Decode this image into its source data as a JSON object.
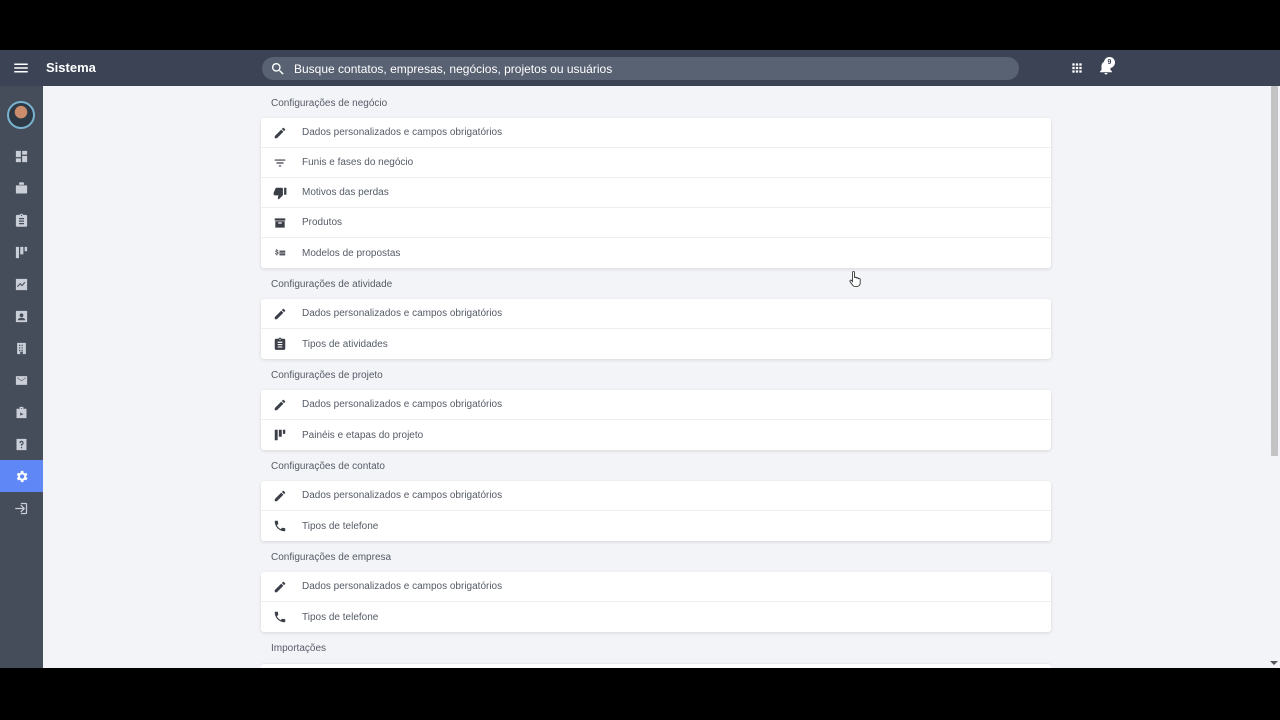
{
  "topbar": {
    "title": "Sistema",
    "search_placeholder": "Busque contatos, empresas, negócios, projetos ou usuários",
    "notification_count": "9"
  },
  "sidebar": {
    "items": [
      {
        "icon": "dashboard-icon"
      },
      {
        "icon": "briefcase-icon"
      },
      {
        "icon": "clipboard-icon"
      },
      {
        "icon": "kanban-icon"
      },
      {
        "icon": "chart-icon"
      },
      {
        "icon": "contact-icon"
      },
      {
        "icon": "building-icon"
      },
      {
        "icon": "mail-icon"
      },
      {
        "icon": "suitcase-icon"
      },
      {
        "icon": "help-icon"
      },
      {
        "icon": "gear-icon",
        "active": true
      },
      {
        "icon": "logout-icon"
      }
    ]
  },
  "sections": [
    {
      "title": "Configurações de negócio",
      "items": [
        {
          "label": "Dados personalizados e campos obrigatórios",
          "icon": "pencil-icon"
        },
        {
          "label": "Funis e fases do negócio",
          "icon": "filter-icon"
        },
        {
          "label": "Motivos das perdas",
          "icon": "thumbs-down-icon"
        },
        {
          "label": "Produtos",
          "icon": "archive-icon"
        },
        {
          "label": "Modelos de propostas",
          "icon": "price-list-icon"
        }
      ]
    },
    {
      "title": "Configurações de atividade",
      "items": [
        {
          "label": "Dados personalizados e campos obrigatórios",
          "icon": "pencil-icon"
        },
        {
          "label": "Tipos de atividades",
          "icon": "clipboard-icon"
        }
      ]
    },
    {
      "title": "Configurações de projeto",
      "items": [
        {
          "label": "Dados personalizados e campos obrigatórios",
          "icon": "pencil-icon"
        },
        {
          "label": "Painéis e etapas do projeto",
          "icon": "kanban-icon"
        }
      ]
    },
    {
      "title": "Configurações de contato",
      "items": [
        {
          "label": "Dados personalizados e campos obrigatórios",
          "icon": "pencil-icon"
        },
        {
          "label": "Tipos de telefone",
          "icon": "phone-icon"
        }
      ]
    },
    {
      "title": "Configurações de empresa",
      "items": [
        {
          "label": "Dados personalizados e campos obrigatórios",
          "icon": "pencil-icon"
        },
        {
          "label": "Tipos de telefone",
          "icon": "phone-icon"
        }
      ]
    },
    {
      "title": "Importações",
      "items": []
    }
  ]
}
